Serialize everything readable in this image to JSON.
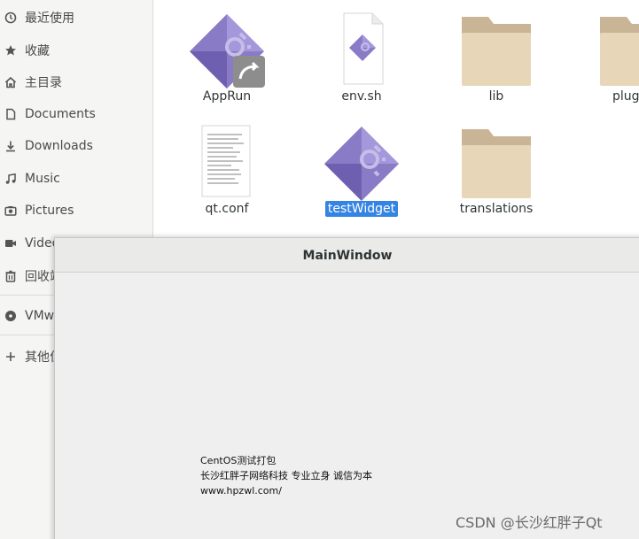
{
  "sidebar": {
    "items": [
      {
        "label": "最近使用",
        "icon": "clock-icon"
      },
      {
        "label": "收藏",
        "icon": "star-icon"
      },
      {
        "label": "主目录",
        "icon": "home-icon"
      },
      {
        "label": "Documents",
        "icon": "document-icon"
      },
      {
        "label": "Downloads",
        "icon": "download-icon"
      },
      {
        "label": "Music",
        "icon": "music-icon"
      },
      {
        "label": "Pictures",
        "icon": "camera-icon"
      },
      {
        "label": "Videos",
        "icon": "video-icon"
      },
      {
        "label": "回收站",
        "icon": "trash-icon"
      },
      {
        "label": "VMware Tools",
        "icon": "disc-icon"
      },
      {
        "label": "其他位置",
        "icon": "plus-icon"
      }
    ]
  },
  "files": [
    {
      "name": "AppRun",
      "icon": "qt-app-symlink-icon",
      "selected": false
    },
    {
      "name": "env.sh",
      "icon": "script-file-icon",
      "selected": false
    },
    {
      "name": "lib",
      "icon": "folder-icon",
      "selected": false
    },
    {
      "name": "plugins",
      "icon": "folder-icon",
      "selected": false
    },
    {
      "name": "qt.conf",
      "icon": "text-file-icon",
      "selected": false
    },
    {
      "name": "testWidget",
      "icon": "qt-app-icon",
      "selected": true
    },
    {
      "name": "translations",
      "icon": "folder-icon",
      "selected": false
    }
  ],
  "main_window": {
    "title": "MainWindow",
    "lines": [
      "CentOS测试打包",
      "长沙红胖子网络科技 专业立身 诚信为本",
      "www.hpzwl.com/"
    ]
  },
  "watermark": "CSDN @长沙红胖子Qt",
  "colors": {
    "selection": "#3584e4",
    "folder": "#e6d3b3",
    "qt_purple": "#8b7bc8"
  }
}
